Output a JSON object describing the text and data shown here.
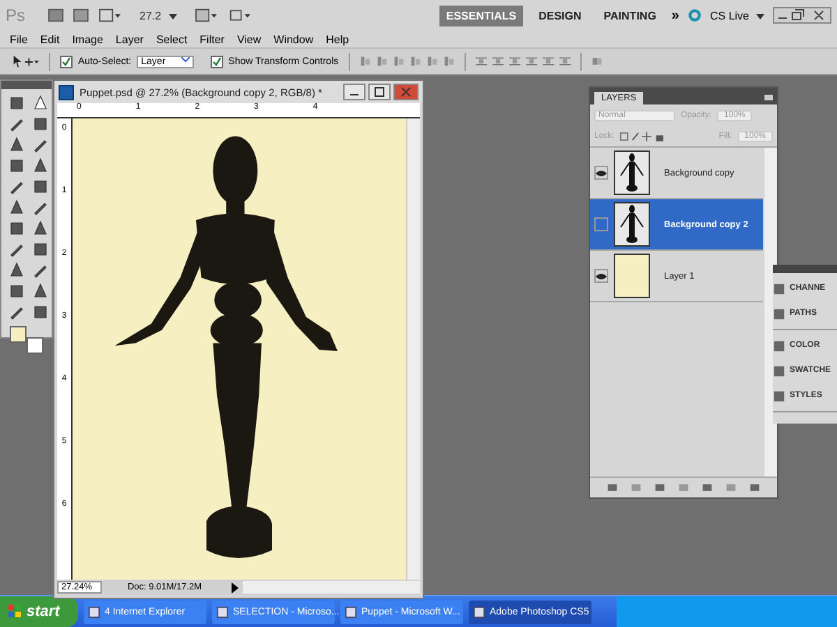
{
  "app_bar": {
    "logo": "Ps",
    "zoom": "27.2",
    "workspaces": [
      {
        "label": "ESSENTIALS",
        "selected": true
      },
      {
        "label": "DESIGN",
        "selected": false
      },
      {
        "label": "PAINTING",
        "selected": false
      }
    ],
    "more": "»",
    "cs_live": "CS Live"
  },
  "menu": [
    "File",
    "Edit",
    "Image",
    "Layer",
    "Select",
    "Filter",
    "View",
    "Window",
    "Help"
  ],
  "options_bar": {
    "auto_select": {
      "label": "Auto-Select:",
      "checked": true
    },
    "target": "Layer",
    "transform": {
      "label": "Show Transform Controls",
      "checked": true
    }
  },
  "document": {
    "title": "Puppet.psd @ 27.2% (Background copy 2, RGB/8) *",
    "ruler_h": [
      "0",
      "1",
      "2",
      "3",
      "4"
    ],
    "ruler_v": [
      "0",
      "1",
      "2",
      "3",
      "4",
      "5",
      "6"
    ],
    "zoom": "27.24%",
    "doc_info": "Doc: 9.01M/17.2M"
  },
  "layers_panel": {
    "tab": "LAYERS",
    "blend": "Normal",
    "opacity_label": "Opacity:",
    "opacity": "100%",
    "lock_label": "Lock:",
    "fill_label": "Fill:",
    "fill": "100%",
    "layers": [
      {
        "name": "Background copy",
        "visible": true,
        "selected": false,
        "kind": "puppet"
      },
      {
        "name": "Background copy 2",
        "visible": false,
        "selected": true,
        "kind": "puppet"
      },
      {
        "name": "Layer 1",
        "visible": true,
        "selected": false,
        "kind": "fill"
      }
    ]
  },
  "dock": [
    [
      "CHANNE",
      "PATHS"
    ],
    [
      "COLOR",
      "SWATCHE",
      "STYLES"
    ]
  ],
  "taskbar": {
    "start": "start",
    "tasks": [
      {
        "label": "4 Internet Explorer",
        "selected": false
      },
      {
        "label": "SELECTION - Microso...",
        "selected": false
      },
      {
        "label": "Puppet - Microsoft W...",
        "selected": false
      },
      {
        "label": "Adobe Photoshop CS5",
        "selected": true
      }
    ]
  }
}
